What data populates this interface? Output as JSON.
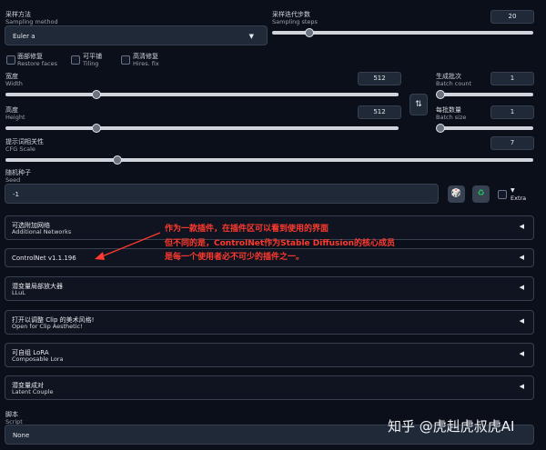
{
  "sampling_method": {
    "label_cn": "采样方法",
    "label_en": "Sampling method",
    "value": "Euler a"
  },
  "sampling_steps": {
    "label_cn": "采样迭代步数",
    "label_en": "Sampling steps",
    "value": "20",
    "fraction": 0.16
  },
  "checkboxes": [
    {
      "cn": "面部修复",
      "en": "Restore faces"
    },
    {
      "cn": "可平铺",
      "en": "Tiling"
    },
    {
      "cn": "高清修复",
      "en": "Hires. fix"
    }
  ],
  "width": {
    "label_cn": "宽度",
    "label_en": "Width",
    "value": "512",
    "fraction": 0.23
  },
  "height": {
    "label_cn": "高度",
    "label_en": "Height",
    "value": "512",
    "fraction": 0.23
  },
  "swap_icon": "swap-arrows-icon",
  "batch_count": {
    "label_cn": "生成批次",
    "label_en": "Batch count",
    "value": "1",
    "fraction": 0.0
  },
  "batch_size": {
    "label_cn": "每批数量",
    "label_en": "Batch size",
    "value": "1",
    "fraction": 0.0
  },
  "cfg_scale": {
    "label_cn": "提示词相关性",
    "label_en": "CFG Scale",
    "value": "7",
    "fraction": 0.21
  },
  "seed": {
    "label_cn": "随机种子",
    "label_en": "Seed",
    "value": "-1"
  },
  "seed_buttons": {
    "dice_icon": "dice-icon",
    "recycle_icon": "recycle-icon",
    "extra_label": "Extra",
    "extra_marker": "▼"
  },
  "panels": [
    {
      "cn": "可选附加网络",
      "en": "Additional Networks"
    },
    {
      "cn": "",
      "en": "ControlNet v1.1.196"
    },
    {
      "cn": "潜变量局部放大器",
      "en": "LLuL"
    },
    {
      "cn": "打开以调整 Clip 的美术风格!",
      "en": "Open for Clip Aesthetic!"
    },
    {
      "cn": "可自组 LoRA",
      "en": "Composable Lora"
    },
    {
      "cn": "潜变量成对",
      "en": "Latent Couple"
    }
  ],
  "panel_arrow": "◀",
  "script": {
    "label_cn": "脚本",
    "label_en": "Script",
    "value": "None"
  },
  "annotation": [
    "作为一款插件，在插件区可以看到使用的界面",
    "但不同的是，ControlNet作为Stable Diffusion的核心成员",
    "是每一个使用者必不可少的插件之一。"
  ],
  "watermark": "知乎 @虎赳虎叔虎AI",
  "colors": {
    "accent": "#ff3a2e",
    "background": "#0b0f19",
    "panel_border": "#374151"
  }
}
